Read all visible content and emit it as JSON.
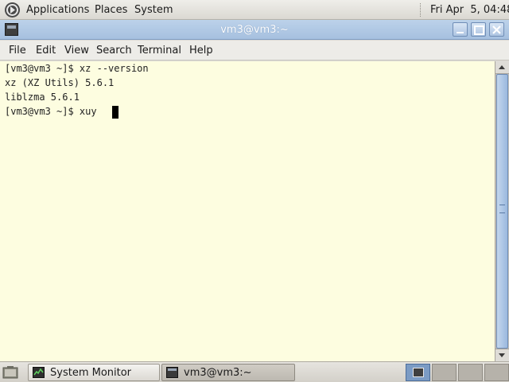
{
  "top_panel": {
    "menus": [
      "Applications",
      "Places",
      "System"
    ],
    "clock": "Fri Apr  5, 04:48"
  },
  "window": {
    "title": "vm3@vm3:~",
    "menubar": [
      "File",
      "Edit",
      "View",
      "Search",
      "Terminal",
      "Help"
    ]
  },
  "terminal": {
    "lines": [
      "[vm3@vm3 ~]$ xz --version",
      "xz (XZ Utils) 5.6.1",
      "liblzma 5.6.1",
      "[vm3@vm3 ~]$ xuy "
    ]
  },
  "taskbar": {
    "tasks": [
      {
        "label": "System Monitor",
        "icon": "system-monitor-icon"
      },
      {
        "label": "vm3@vm3:~",
        "icon": "terminal-icon"
      }
    ]
  },
  "colors": {
    "terminal_background": "#fdfde0",
    "titlebar": "#a6c0df",
    "panel": "#dad8d2",
    "active_workspace": "#7b9bc4"
  }
}
